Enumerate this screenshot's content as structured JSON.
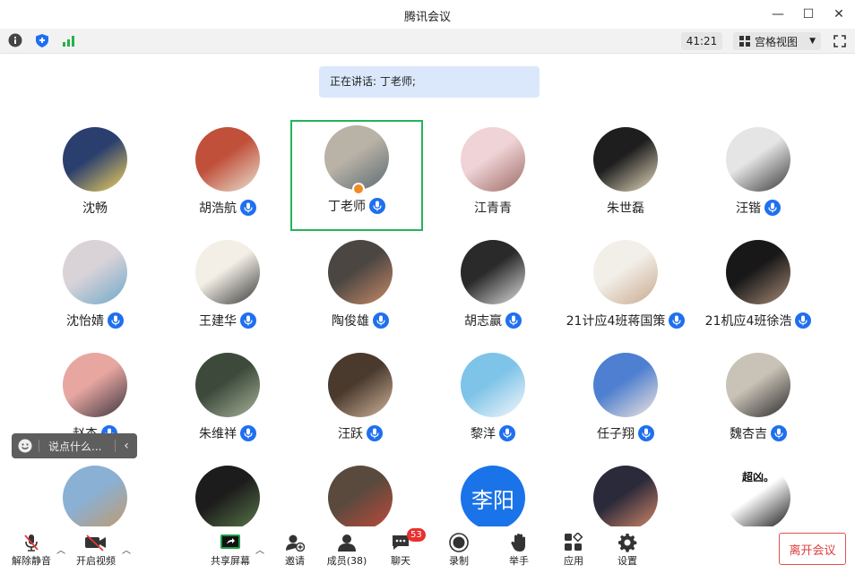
{
  "window": {
    "title": "腾讯会议"
  },
  "toolbar": {
    "timer": "41:21",
    "view_label": "宫格视图"
  },
  "speaking": {
    "text": "正在讲话: 丁老师;"
  },
  "participants": [
    {
      "name": "沈畅",
      "mic": false,
      "colors": [
        "#2a3f6e",
        "#f4d35e"
      ]
    },
    {
      "name": "胡浩航",
      "mic": true,
      "colors": [
        "#c0503a",
        "#e9e2d2"
      ]
    },
    {
      "name": "丁老师",
      "mic": true,
      "colors": [
        "#b9b2a6",
        "#5c6b73"
      ]
    },
    {
      "name": "江青青",
      "mic": false,
      "colors": [
        "#f0d3d6",
        "#9c6b65"
      ]
    },
    {
      "name": "朱世磊",
      "mic": false,
      "colors": [
        "#1e1e1e",
        "#e8dcc0"
      ]
    },
    {
      "name": "汪锴",
      "mic": true,
      "colors": [
        "#e5e5e5",
        "#3a3a3a"
      ]
    },
    {
      "name": "沈怡婧",
      "mic": true,
      "colors": [
        "#d9d3d8",
        "#6fa8c9"
      ]
    },
    {
      "name": "王建华",
      "mic": true,
      "colors": [
        "#f3efe6",
        "#3a3a3a"
      ]
    },
    {
      "name": "陶俊雄",
      "mic": true,
      "colors": [
        "#4b4642",
        "#c98a68"
      ]
    },
    {
      "name": "胡志赢",
      "mic": true,
      "colors": [
        "#2a2a2a",
        "#dedede"
      ]
    },
    {
      "name": "21计应4班蒋国策",
      "mic": true,
      "colors": [
        "#f2efe9",
        "#c8a98d"
      ]
    },
    {
      "name": "21机应4班徐浩",
      "mic": true,
      "colors": [
        "#181818",
        "#a88b76"
      ]
    },
    {
      "name": "赵杰",
      "mic": true,
      "colors": [
        "#e8a6a0",
        "#3b3540"
      ]
    },
    {
      "name": "朱维祥",
      "mic": true,
      "colors": [
        "#3d4a3b",
        "#a8b29a"
      ]
    },
    {
      "name": "汪跃",
      "mic": true,
      "colors": [
        "#4a3a2e",
        "#d1b49a"
      ]
    },
    {
      "name": "黎洋",
      "mic": true,
      "colors": [
        "#7ec3e8",
        "#f5f8fb"
      ]
    },
    {
      "name": "任子翔",
      "mic": true,
      "colors": [
        "#4e7fd0",
        "#f1e6de"
      ]
    },
    {
      "name": "魏杏吉",
      "mic": true,
      "colors": [
        "#c9c2b6",
        "#2b2b2b"
      ]
    },
    {
      "name": "",
      "mic": false,
      "colors": [
        "#8ab0d4",
        "#c29a6a"
      ]
    },
    {
      "name": "",
      "mic": false,
      "colors": [
        "#1c1c1c",
        "#5a7a4a"
      ]
    },
    {
      "name": "",
      "mic": false,
      "colors": [
        "#5a4a3e",
        "#c04a3a"
      ]
    },
    {
      "name": "",
      "mic": false,
      "colors": [
        "#1a73e8",
        "#1a73e8"
      ],
      "avatar_text": "李阳"
    },
    {
      "name": "",
      "mic": false,
      "colors": [
        "#2a2a3a",
        "#d98a6a"
      ]
    },
    {
      "name": "",
      "mic": false,
      "colors": [
        "#ffffff",
        "#111111"
      ],
      "avatar_text": "超凶。"
    }
  ],
  "chat": {
    "placeholder": "说点什么..."
  },
  "bottom": {
    "unmute": "解除静音",
    "video": "开启视频",
    "share": "共享屏幕",
    "invite": "邀请",
    "members": "成员(38)",
    "chat": "聊天",
    "chat_badge": "53",
    "record": "录制",
    "raise_hand": "举手",
    "apps": "应用",
    "settings": "设置",
    "leave": "离开会议"
  },
  "colors": {
    "accent": "#1f6ff0",
    "active_border": "#25b35a",
    "leave": "#e03b3b"
  }
}
